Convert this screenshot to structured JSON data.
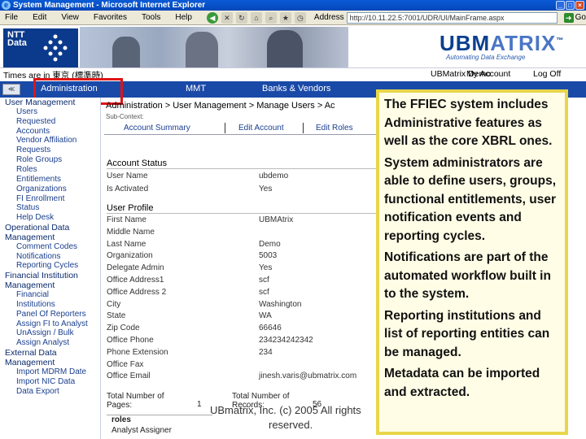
{
  "window": {
    "title": "System Management - Microsoft Internet Explorer",
    "menu": [
      "File",
      "Edit",
      "View",
      "Favorites",
      "Tools",
      "Help"
    ],
    "address_label": "Address",
    "address_value": "http://10.11.22.5:7001/UDR/UI/MainFrame.aspx",
    "go_label": "Go"
  },
  "banner": {
    "ntt_text": "NTT\nData",
    "ub_main": "UBM",
    "ub_accent": "ATRIX",
    "ub_tm": "™",
    "ub_tagline": "Automating Data Exchange"
  },
  "timerow": {
    "timezone": "Times are in 東京 (標準時)",
    "links": [
      "UBMatrix Demo",
      "My Account",
      "Log Off"
    ]
  },
  "tabs": [
    "Administration",
    "MMT",
    "Banks & Vendors"
  ],
  "sidebar": [
    {
      "type": "head",
      "label": "User Management"
    },
    {
      "type": "item",
      "label": "Users"
    },
    {
      "type": "item",
      "label": "Requested"
    },
    {
      "type": "item",
      "label": "Accounts"
    },
    {
      "type": "item",
      "label": "Vendor Affiliation"
    },
    {
      "type": "item",
      "label": "Requests"
    },
    {
      "type": "item",
      "label": "Role Groups"
    },
    {
      "type": "item",
      "label": "Roles"
    },
    {
      "type": "item",
      "label": "Entitlements"
    },
    {
      "type": "item",
      "label": "Organizations"
    },
    {
      "type": "item",
      "label": "FI Enrollment"
    },
    {
      "type": "item",
      "label": "Status"
    },
    {
      "type": "item",
      "label": "Help Desk"
    },
    {
      "type": "head",
      "label": "Operational Data"
    },
    {
      "type": "head",
      "label": "Management"
    },
    {
      "type": "item",
      "label": "Comment Codes"
    },
    {
      "type": "item",
      "label": "Notifications"
    },
    {
      "type": "item",
      "label": "Reporting Cycles"
    },
    {
      "type": "head",
      "label": "Financial Institution"
    },
    {
      "type": "head",
      "label": "Management"
    },
    {
      "type": "item",
      "label": "Financial"
    },
    {
      "type": "item",
      "label": "Institutions"
    },
    {
      "type": "item",
      "label": "Panel Of Reporters"
    },
    {
      "type": "item",
      "label": "Assign FI to Analyst"
    },
    {
      "type": "item",
      "label": "UnAssign / Bulk"
    },
    {
      "type": "item",
      "label": "Assign Analyst"
    },
    {
      "type": "head",
      "label": "External Data"
    },
    {
      "type": "head",
      "label": "Management"
    },
    {
      "type": "item",
      "label": "Import MDRM Date"
    },
    {
      "type": "item",
      "label": "Import NIC Data"
    },
    {
      "type": "item",
      "label": "Data Export"
    }
  ],
  "main": {
    "breadcrumb": "Administration > User Management > Manage Users > Ac",
    "subcontext": "Sub-Context:",
    "subtabs": [
      "Account Summary",
      "Edit Account",
      "Edit Roles"
    ],
    "account_status_title": "Account Status",
    "account_status": [
      {
        "label": "User Name",
        "value": "ubdemo"
      },
      {
        "label": "Is Activated",
        "value": "Yes"
      }
    ],
    "user_profile_title": "User Profile",
    "user_profile": [
      {
        "label": "First Name",
        "value": "UBMAtrix"
      },
      {
        "label": "Middle Name",
        "value": ""
      },
      {
        "label": "Last Name",
        "value": "Demo"
      },
      {
        "label": "Organization",
        "value": "5003"
      },
      {
        "label": "Delegate Admin",
        "value": "Yes"
      },
      {
        "label": "Office Address1",
        "value": "scf"
      },
      {
        "label": "Office Address 2",
        "value": "scf"
      },
      {
        "label": "City",
        "value": "Washington"
      },
      {
        "label": "State",
        "value": "WA"
      },
      {
        "label": "Zip Code",
        "value": "66646"
      },
      {
        "label": "Office Phone",
        "value": "234234242342"
      },
      {
        "label": "Phone Extension",
        "value": "234"
      },
      {
        "label": "Office Fax",
        "value": ""
      },
      {
        "label": "Office Email",
        "value": "jinesh.varis@ubmatrix.com"
      }
    ],
    "footer": {
      "total_pages_label": "Total Number of Pages:",
      "total_pages_value": "1",
      "total_records_label": "Total Number of Records:",
      "total_records_value": "56",
      "roles_header": "roles",
      "roles_first": "Analyst Assigner"
    }
  },
  "callout": [
    "The FFIEC system includes Administrative features as well as the core XBRL ones.",
    "System administrators are able to define users, groups, functional entitlements, user notification events and reporting cycles.",
    "Notifications are part of the automated workflow built in to the system.",
    "Reporting institutions and list of reporting entities can be managed.",
    "Metadata can be imported and extracted."
  ],
  "copyright": {
    "line1": "UBmatrix, Inc. (c) 2005 All rights",
    "line2": "reserved."
  }
}
